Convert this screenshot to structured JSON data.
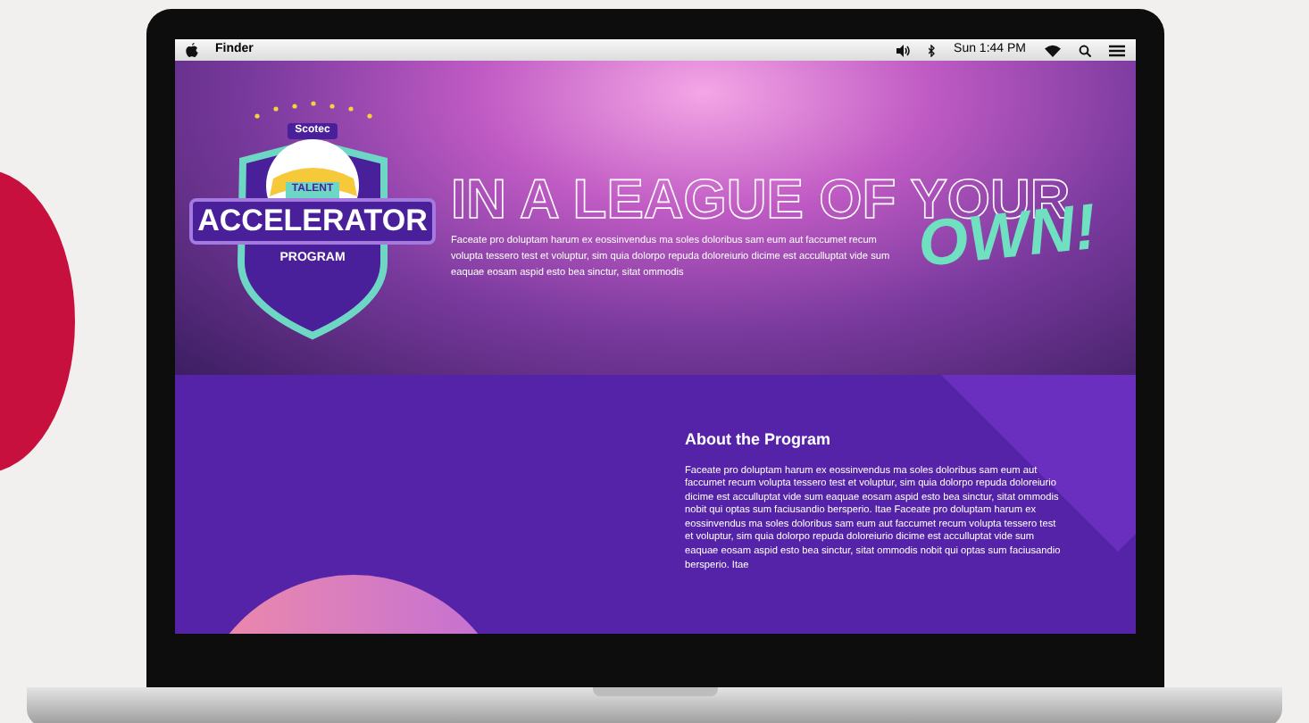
{
  "menu_bar": {
    "app": "Finder",
    "clock": "Sun 1:44 PM"
  },
  "hero": {
    "badge": {
      "brand": "Scotec",
      "top": "TALENT",
      "main": "ACCELERATOR",
      "bottom": "PROGRAM"
    },
    "headline": "IN A LEAGUE OF YOUR",
    "accent": "OWN!",
    "text": "Faceate pro doluptam harum ex eossinvendus ma soles doloribus sam eum aut faccumet recum volupta tessero test et voluptur, sim quia dolorpo repuda doloreiurio dicime est acculluptat vide sum eaquae eosam aspid esto bea sinctur, sitat ommodis"
  },
  "about": {
    "title": "About the Program",
    "text": "Faceate pro doluptam harum ex eossinvendus ma soles doloribus sam eum aut faccumet recum volupta tessero test et voluptur, sim quia dolorpo repuda doloreiurio dicime est acculluptat vide sum eaquae eosam aspid esto bea sinctur, sitat ommodis nobit qui optas sum faciusandio bersperio. Itae Faceate pro doluptam harum ex eossinvendus ma soles doloribus sam eum aut faccumet recum volupta tessero test et voluptur, sim quia dolorpo repuda doloreiurio dicime est acculluptat vide sum eaquae eosam aspid esto bea sinctur, sitat ommodis nobit qui optas sum faciusandio bersperio. Itae"
  }
}
